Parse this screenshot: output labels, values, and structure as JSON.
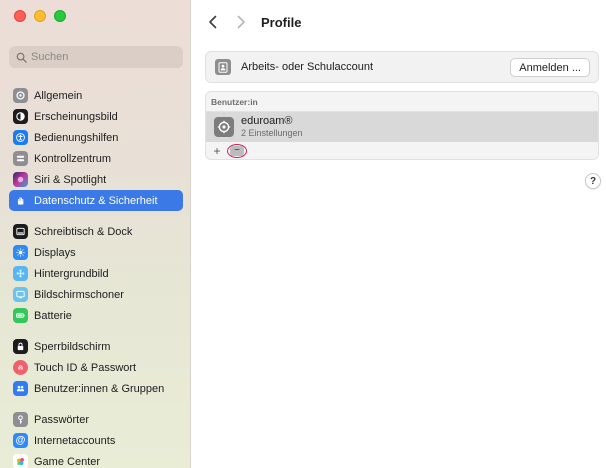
{
  "window": {
    "title": "Profile"
  },
  "sidebar": {
    "search_placeholder": "Suchen",
    "items": [
      {
        "label": "Allgemein",
        "icon": "gear-icon",
        "color": "#8e8e93",
        "active": false
      },
      {
        "label": "Erscheinungsbild",
        "icon": "appearance-icon",
        "color": "#1c1c1e",
        "active": false
      },
      {
        "label": "Bedienungshilfen",
        "icon": "accessibility-icon",
        "color": "#1a7cf5",
        "active": false
      },
      {
        "label": "Kontrollzentrum",
        "icon": "control-center-icon",
        "color": "#8e8e93",
        "active": false
      },
      {
        "label": "Siri & Spotlight",
        "icon": "siri-icon",
        "color": "#5b3fa6",
        "active": false
      },
      {
        "label": "Datenschutz & Sicherheit",
        "icon": "hand-icon",
        "color": "#3a79e6",
        "active": true
      },
      {
        "label": "Schreibtisch & Dock",
        "icon": "dock-icon",
        "color": "#1c1c1e",
        "active": false
      },
      {
        "label": "Displays",
        "icon": "sun-icon",
        "color": "#2e8af6",
        "active": false
      },
      {
        "label": "Hintergrundbild",
        "icon": "wallpaper-icon",
        "color": "#58b7f2",
        "active": false
      },
      {
        "label": "Bildschirmschoner",
        "icon": "screensaver-icon",
        "color": "#6cc2e8",
        "active": false
      },
      {
        "label": "Batterie",
        "icon": "battery-icon",
        "color": "#34c759",
        "active": false
      },
      {
        "label": "Sperrbildschirm",
        "icon": "lock-icon",
        "color": "#1c1c1e",
        "active": false
      },
      {
        "label": "Touch ID & Passwort",
        "icon": "fingerprint-icon",
        "color": "#f2616b",
        "active": false
      },
      {
        "label": "Benutzer:innen & Gruppen",
        "icon": "users-icon",
        "color": "#2f7cf6",
        "active": false
      },
      {
        "label": "Passwörter",
        "icon": "key-icon",
        "color": "#8e8e93",
        "active": false
      },
      {
        "label": "Internetaccounts",
        "icon": "at-icon",
        "color": "#2e8af6",
        "active": false
      },
      {
        "label": "Game Center",
        "icon": "game-center-icon",
        "color": "#f5a623",
        "active": false
      }
    ]
  },
  "main": {
    "work_account_label": "Arbeits- oder Schulaccount",
    "sign_in_label": "Anmelden ...",
    "users_header": "Benutzer:in",
    "profile": {
      "name": "eduroam®",
      "subtitle": "2 Einstellungen"
    },
    "add_symbol": "+",
    "remove_symbol": "−",
    "help_symbol": "?"
  },
  "colors": {
    "accent": "#3a79e6",
    "highlight_ring": "#d0205a"
  }
}
